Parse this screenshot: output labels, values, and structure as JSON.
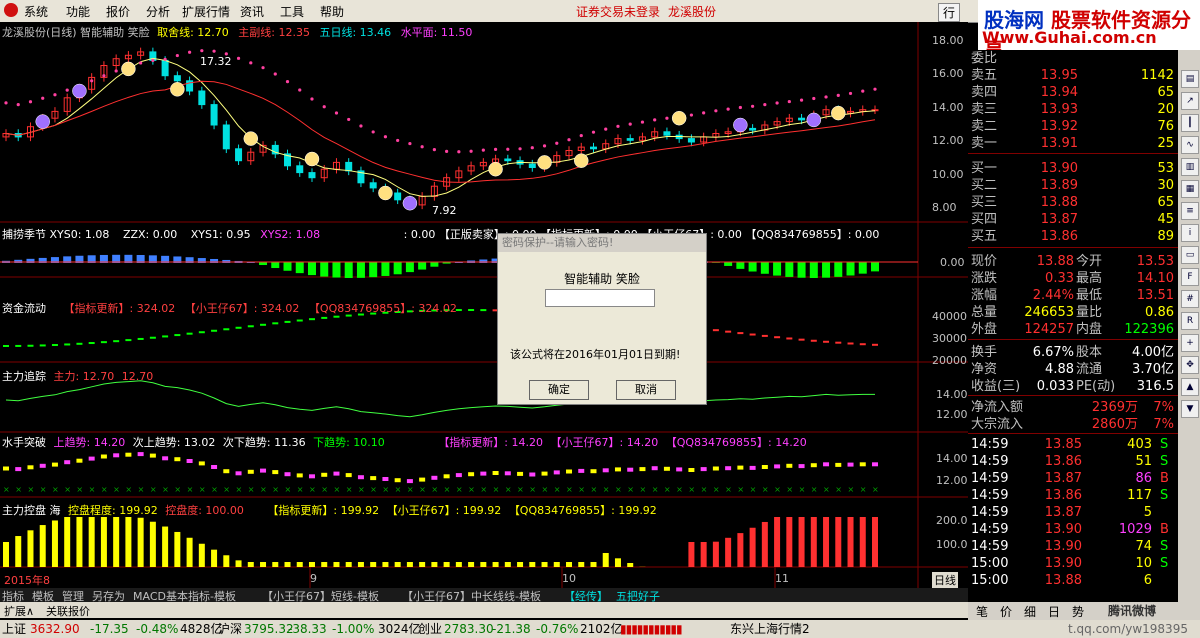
{
  "menu": {
    "items": [
      "系统",
      "功能",
      "报价",
      "分析",
      "扩展行情",
      "资讯",
      "工具",
      "帮助"
    ],
    "login_notice": "证券交易未登录",
    "stock_name": "龙溪股份",
    "right_tab": "行"
  },
  "watermark": {
    "line1_a": "股海网",
    "line1_b": "股票软件资源分享",
    "line2": "Www.Guhai.com.cn"
  },
  "main_chart": {
    "title": "龙溪股份(日线) 智能辅助 笑脸",
    "ma1": "取舍线: 12.70",
    "ma2": "主副线: 12.35",
    "ma3": "五日线: 13.46",
    "ma4": "水平面: 11.50",
    "high_label": "17.32",
    "low_label": "7.92",
    "yticks": [
      "18.00",
      "16.00",
      "14.00",
      "12.00",
      "10.00",
      "8.00"
    ]
  },
  "pane2": {
    "title_parts": [
      "捕捞季节 XYS0: 1.08",
      "ZZX: 0.00",
      "XYS1: 0.95",
      "XYS2: 1.08",
      ": 0.00 【正版卖家】: 0.00 【指标更新】: 0.00 【小王仔67】: 0.00 【QQ834769855】: 0.00"
    ],
    "yticks": [
      "0.00"
    ]
  },
  "pane3": {
    "title_parts": [
      "资金流动",
      "【指标更新】: 324.02",
      "【小王仔67】: 324.02",
      "【QQ834769855】: 324.02"
    ],
    "yticks": [
      "40000",
      "30000",
      "20000"
    ]
  },
  "pane4": {
    "title_parts": [
      "主力追踪",
      "主力: 12.70",
      "12.70"
    ],
    "yticks": [
      "14.00",
      "12.00"
    ]
  },
  "pane5": {
    "title_parts": [
      "水手突破",
      "上趋势: 14.20",
      "次上趋势: 13.02",
      "次下趋势: 11.36",
      "下趋势: 10.10",
      "【指标更新】: 14.20",
      "【小王仔67】: 14.20",
      "【QQ834769855】: 14.20"
    ],
    "yticks": [
      "14.00",
      "12.00"
    ]
  },
  "pane6": {
    "title_parts": [
      "主力控盘 海",
      "控盘程度: 199.92",
      "控盘度: 100.00",
      "【指标更新】: 199.92",
      "【小王仔67】: 199.92",
      "【QQ834769855】: 199.92"
    ],
    "yticks": [
      "200.0",
      "100.0"
    ]
  },
  "xaxis": {
    "labels": [
      "2015年8",
      "9",
      "10",
      "11"
    ],
    "period": "日线"
  },
  "dialog": {
    "title": "密码保护--请输入密码!",
    "prompt": "智能辅助 笑脸",
    "input_value": "",
    "message": "该公式将在2016年01月01日到期!",
    "ok_label": "确定",
    "cancel_label": "取消"
  },
  "order_book": {
    "header": "委比",
    "asks": [
      {
        "label": "卖五",
        "price": "13.95",
        "vol": "1142"
      },
      {
        "label": "卖四",
        "price": "13.94",
        "vol": "65"
      },
      {
        "label": "卖三",
        "price": "13.93",
        "vol": "20"
      },
      {
        "label": "卖二",
        "price": "13.92",
        "vol": "76"
      },
      {
        "label": "卖一",
        "price": "13.91",
        "vol": "25"
      }
    ],
    "bids": [
      {
        "label": "买一",
        "price": "13.90",
        "vol": "53"
      },
      {
        "label": "买二",
        "price": "13.89",
        "vol": "30"
      },
      {
        "label": "买三",
        "price": "13.88",
        "vol": "65"
      },
      {
        "label": "买四",
        "price": "13.87",
        "vol": "45"
      },
      {
        "label": "买五",
        "price": "13.86",
        "vol": "89"
      }
    ]
  },
  "quote": {
    "rows": [
      {
        "l1": "现价",
        "v1": "13.88",
        "l2": "今开",
        "v2": "13.53"
      },
      {
        "l1": "涨跌",
        "v1": "0.33",
        "l2": "最高",
        "v2": "14.10"
      },
      {
        "l1": "涨幅",
        "v1": "2.44%",
        "l2": "最低",
        "v2": "13.51"
      },
      {
        "l1": "总量",
        "v1": "246653",
        "l2": "量比",
        "v2": "0.86"
      },
      {
        "l1": "外盘",
        "v1": "124257",
        "l2": "内盘",
        "v2": "122396"
      }
    ],
    "rows2": [
      {
        "l1": "换手",
        "v1": "6.67%",
        "l2": "股本",
        "v2": "4.00亿"
      },
      {
        "l1": "净资",
        "v1": "4.88",
        "l2": "流通",
        "v2": "3.70亿"
      },
      {
        "l1": "收益(三)",
        "v1": "0.033",
        "l2": "PE(动)",
        "v2": "316.5"
      }
    ],
    "flows": [
      {
        "label": "净流入额",
        "value": "2369万",
        "pct": "7%"
      },
      {
        "label": "大宗流入",
        "value": "2860万",
        "pct": "7%"
      }
    ]
  },
  "ticks": [
    {
      "time": "14:59",
      "price": "13.85",
      "vol": "403",
      "side": "S"
    },
    {
      "time": "14:59",
      "price": "13.86",
      "vol": "51",
      "side": "S"
    },
    {
      "time": "14:59",
      "price": "13.87",
      "vol": "86",
      "side": "B"
    },
    {
      "time": "14:59",
      "price": "13.86",
      "vol": "117",
      "side": "S"
    },
    {
      "time": "14:59",
      "price": "13.87",
      "vol": "5",
      "side": ""
    },
    {
      "time": "14:59",
      "price": "13.90",
      "vol": "1029",
      "side": "B"
    },
    {
      "time": "14:59",
      "price": "13.90",
      "vol": "74",
      "side": "S"
    },
    {
      "time": "15:00",
      "price": "13.90",
      "vol": "10",
      "side": "S"
    },
    {
      "time": "15:00",
      "price": "13.88",
      "vol": "6",
      "side": ""
    }
  ],
  "bottom_tabs": [
    "指标",
    "模板",
    "管理",
    "另存为",
    "MACD基本指标-模板",
    "【小王仔67】短线-模板",
    "【小王仔67】中长线线-模板",
    "【经传】",
    "五把好子"
  ],
  "sub_tabs": [
    "扩展∧",
    "关联报价"
  ],
  "right_tabs": [
    "笔",
    "价",
    "细",
    "日",
    "势"
  ],
  "status": {
    "sh_label": "上证",
    "sh_val": "3632.90",
    "sh_chg": "-17.35",
    "sh_pct": "-0.48%",
    "sh_amt": "4828亿",
    "sz_label": "沪深",
    "sz_val": "3795.32",
    "sz_chg": "-38.33",
    "sz_pct": "-1.00%",
    "sz_amt": "3024亿",
    "cy_label": "创业",
    "cy_val": "2783.30",
    "cy_chg": "-21.38",
    "cy_pct": "-0.76%",
    "cy_amt": "2102亿",
    "market": "东兴上海行情2",
    "url": "t.qq.com/yw198395",
    "weibo": "腾讯微博"
  },
  "colors": {
    "up": "#ff3030",
    "down": "#00e0e0",
    "bg": "#000000",
    "axis": "#800000",
    "accent_yellow": "#ffff00"
  }
}
